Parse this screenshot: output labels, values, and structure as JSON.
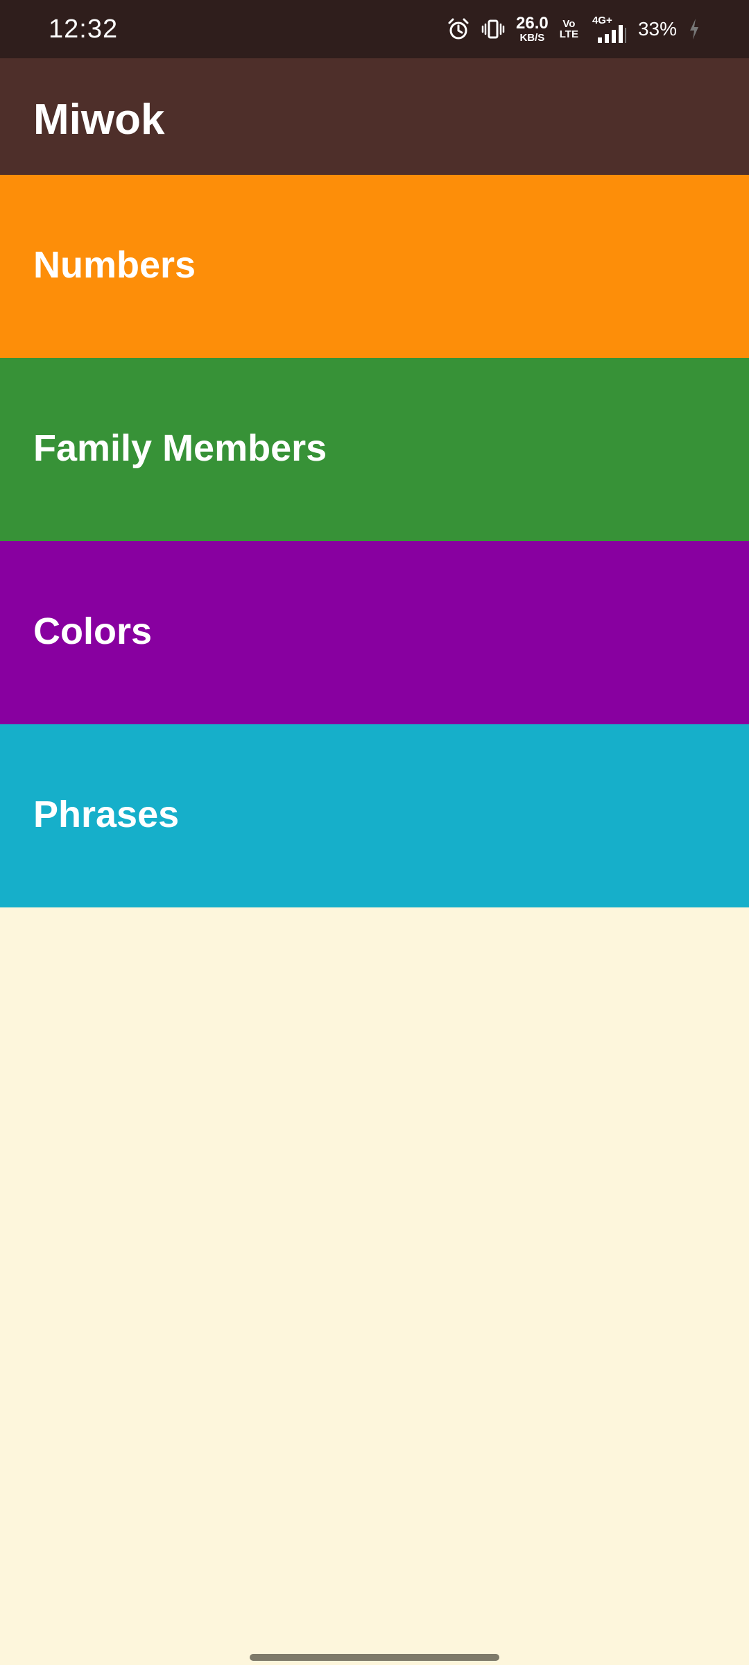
{
  "status_bar": {
    "time": "12:32",
    "net_speed_value": "26.0",
    "net_speed_unit": "KB/S",
    "volte_top": "Vo",
    "volte_bottom": "LTE",
    "network_type": "4G+",
    "battery": "33%",
    "icons": [
      "alarm-icon",
      "vibrate-icon",
      "signal-icon",
      "charging-icon"
    ]
  },
  "app_bar": {
    "title": "Miwok",
    "color": "#4E2F2A"
  },
  "categories": [
    {
      "label": "Numbers",
      "color": "#FD8E09"
    },
    {
      "label": "Family Members",
      "color": "#379237"
    },
    {
      "label": "Colors",
      "color": "#8800A0"
    },
    {
      "label": "Phrases",
      "color": "#16AFCA"
    }
  ],
  "colors": {
    "status_bar": "#2F1E1C",
    "background": "#FDF6DC",
    "text": "#FFFFFF"
  }
}
